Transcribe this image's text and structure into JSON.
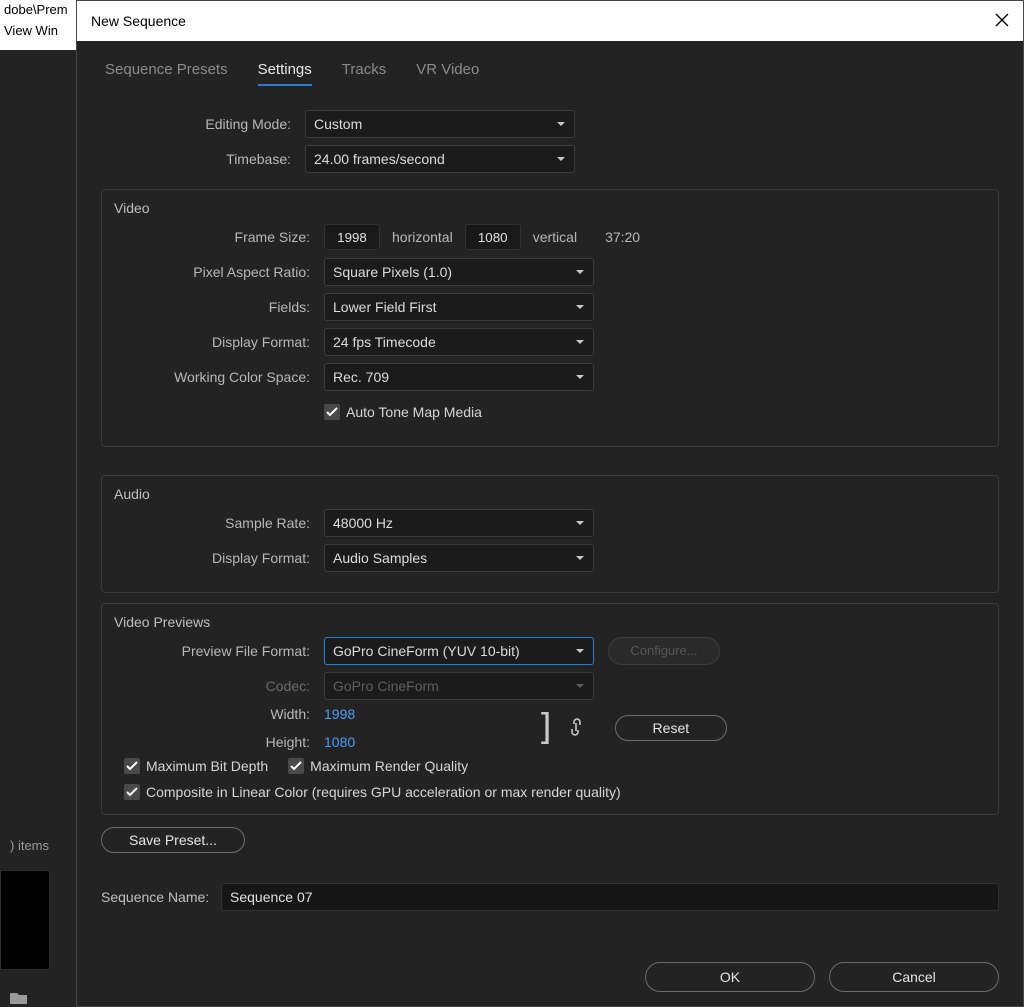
{
  "bg": {
    "path_fragment": "dobe\\Prem",
    "menu_fragment": "View   Win",
    "items_label": ") items"
  },
  "dialog": {
    "title": "New Sequence",
    "tabs": [
      "Sequence Presets",
      "Settings",
      "Tracks",
      "VR Video"
    ],
    "active_tab": 1,
    "editing_mode_label": "Editing Mode:",
    "editing_mode": "Custom",
    "timebase_label": "Timebase:",
    "timebase": "24.00  frames/second",
    "video": {
      "title": "Video",
      "frame_size_label": "Frame Size:",
      "h": "1998",
      "horizontal": "horizontal",
      "v": "1080",
      "vertical": "vertical",
      "ratio": "37:20",
      "par_label": "Pixel Aspect Ratio:",
      "par": "Square Pixels (1.0)",
      "fields_label": "Fields:",
      "fields": "Lower Field First",
      "display_format_label": "Display Format:",
      "display_format": "24 fps Timecode",
      "wcs_label": "Working Color Space:",
      "wcs": "Rec. 709",
      "auto_tone": "Auto Tone Map Media"
    },
    "audio": {
      "title": "Audio",
      "sample_rate_label": "Sample Rate:",
      "sample_rate": "48000 Hz",
      "display_format_label": "Display Format:",
      "display_format": "Audio Samples"
    },
    "previews": {
      "title": "Video Previews",
      "pff_label": "Preview File Format:",
      "pff": "GoPro CineForm (YUV 10-bit)",
      "configure": "Configure...",
      "codec_label": "Codec:",
      "codec": "GoPro CineForm",
      "width_label": "Width:",
      "width": "1998",
      "height_label": "Height:",
      "height": "1080",
      "reset": "Reset",
      "max_bit_depth": "Maximum Bit Depth",
      "max_render_quality": "Maximum Render Quality",
      "composite": "Composite in Linear Color (requires GPU acceleration or max render quality)"
    },
    "save_preset": "Save Preset...",
    "sequence_name_label": "Sequence Name:",
    "sequence_name": "Sequence 07",
    "ok": "OK",
    "cancel": "Cancel"
  }
}
